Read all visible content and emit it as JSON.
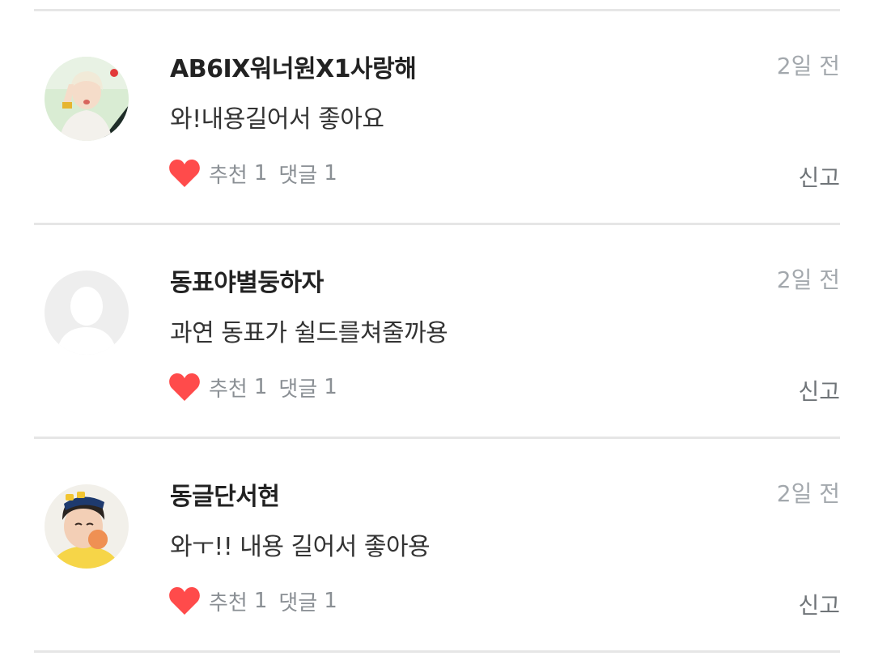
{
  "colors": {
    "heart": "#ff4b4b",
    "divider": "#e6e6e6",
    "meta_text": "#8a8f94",
    "timestamp": "#a3a8ad"
  },
  "comments": [
    {
      "username": "AB6IX워너원X1사랑해",
      "time": "2일 전",
      "text": "와!내용길어서 좋아요",
      "like_label": "추천",
      "like_count": "1",
      "reply_label": "댓글",
      "reply_count": "1",
      "report_label": "신고",
      "avatar": "profile-photo"
    },
    {
      "username": "동표야별둥하자",
      "time": "2일 전",
      "text": "과연 동표가 쉴드를쳐줄까용",
      "like_label": "추천",
      "like_count": "1",
      "reply_label": "댓글",
      "reply_count": "1",
      "report_label": "신고",
      "avatar": "default-avatar"
    },
    {
      "username": "동글단서현",
      "time": "2일 전",
      "text": "와ㅜ!! 내용 길어서 좋아용",
      "like_label": "추천",
      "like_count": "1",
      "reply_label": "댓글",
      "reply_count": "1",
      "report_label": "신고",
      "avatar": "profile-photo"
    }
  ]
}
